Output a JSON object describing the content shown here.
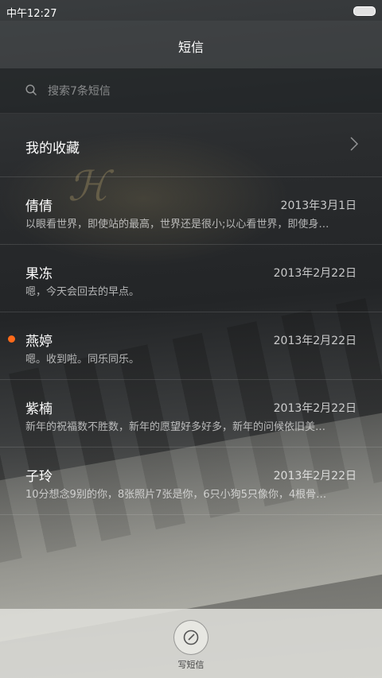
{
  "status_bar": {
    "time": "中午12:27"
  },
  "header": {
    "title": "短信"
  },
  "search": {
    "placeholder": "搜索7条短信"
  },
  "favorites": {
    "label": "我的收藏"
  },
  "conversations": [
    {
      "name": "倩倩",
      "date": "2013年3月1日",
      "preview": "以眼看世界，即使站的最高，世界还是很小;以心看世界，即使身…",
      "unread": false
    },
    {
      "name": "果冻",
      "date": "2013年2月22日",
      "preview": "嗯，今天会回去的早点。",
      "unread": false
    },
    {
      "name": "燕婷",
      "date": "2013年2月22日",
      "preview": "嗯。收到啦。同乐同乐。",
      "unread": true
    },
    {
      "name": "紫楠",
      "date": "2013年2月22日",
      "preview": "新年的祝福数不胜数，新年的愿望好多好多，新年的问候依旧美…",
      "unread": false
    },
    {
      "name": "子玲",
      "date": "2013年2月22日",
      "preview": "10分想念9别的你，8张照片7张是你，6只小狗5只像你，4根骨…",
      "unread": false
    }
  ],
  "bottom": {
    "compose_label": "写短信"
  },
  "colors": {
    "unread_dot": "#ff6a1a",
    "bottom_bar": "#e1e1dc"
  },
  "icons": [
    "search-icon",
    "chevron-right-icon",
    "compose-icon",
    "battery-icon"
  ]
}
